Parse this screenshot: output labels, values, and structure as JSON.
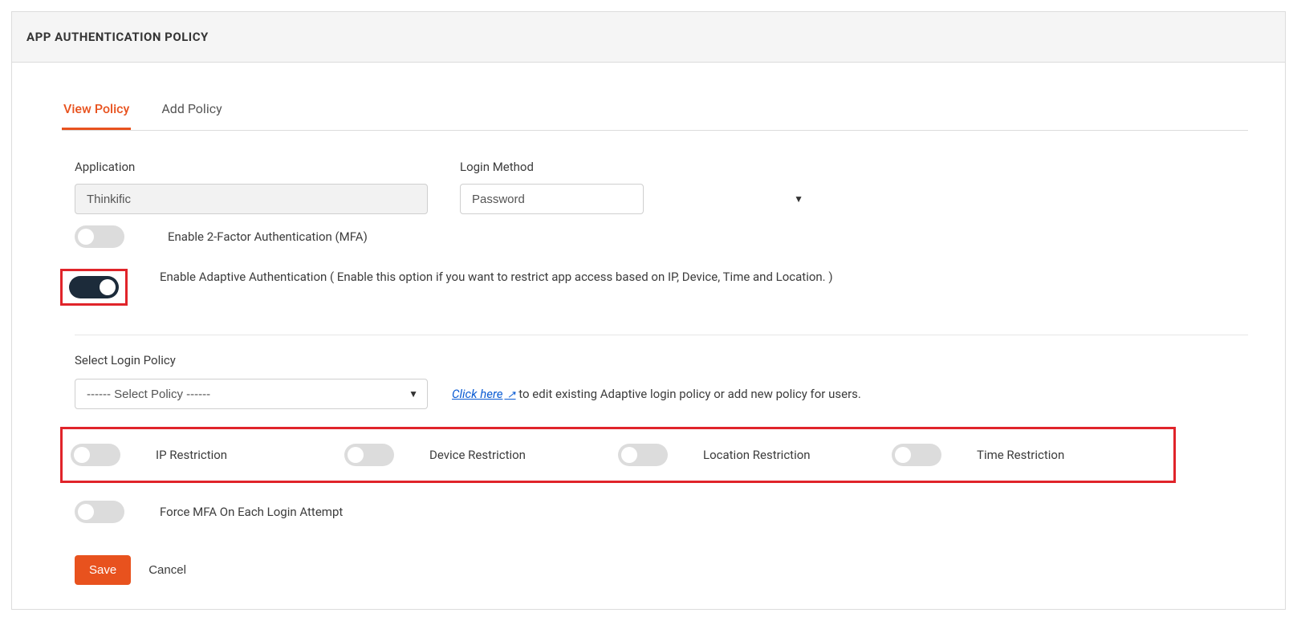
{
  "header": {
    "title": "APP AUTHENTICATION POLICY"
  },
  "tabs": {
    "view": "View Policy",
    "add": "Add Policy",
    "active": "view"
  },
  "fields": {
    "application": {
      "label": "Application",
      "value": "Thinkific"
    },
    "loginMethod": {
      "label": "Login Method",
      "value": "Password"
    }
  },
  "toggles": {
    "mfa": {
      "label": "Enable 2-Factor Authentication (MFA)",
      "on": false
    },
    "adaptive": {
      "label": "Enable Adaptive Authentication ( Enable this option if you want to restrict app access based on IP, Device, Time and Location. )",
      "on": true
    },
    "forceMfa": {
      "label": "Force MFA On Each Login Attempt",
      "on": false
    }
  },
  "loginPolicy": {
    "label": "Select Login Policy",
    "selected": "------ Select Policy ------",
    "hint_link": "Click here",
    "hint_rest": " to edit existing Adaptive login policy or add new policy for users."
  },
  "restrictions": {
    "ip": {
      "label": "IP Restriction",
      "on": false
    },
    "device": {
      "label": "Device Restriction",
      "on": false
    },
    "location": {
      "label": "Location Restriction",
      "on": false
    },
    "time": {
      "label": "Time Restriction",
      "on": false
    }
  },
  "buttons": {
    "save": "Save",
    "cancel": "Cancel"
  }
}
